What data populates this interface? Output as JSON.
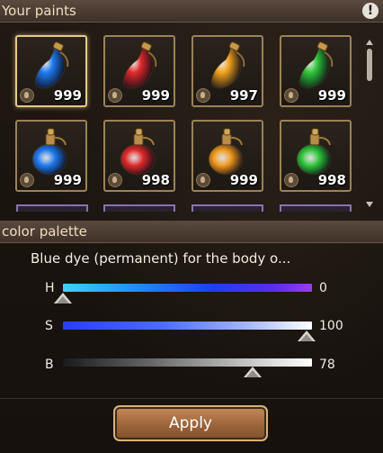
{
  "paints_header": {
    "title": "Your paints",
    "alert_icon": "!"
  },
  "paints": [
    {
      "color": "blue",
      "shape": "flask",
      "count": "999",
      "selected": true,
      "hex": "#1e7bf0"
    },
    {
      "color": "red",
      "shape": "flask",
      "count": "999",
      "selected": false,
      "hex": "#e02a2a"
    },
    {
      "color": "orange",
      "shape": "flask",
      "count": "997",
      "selected": false,
      "hex": "#f2a21c"
    },
    {
      "color": "green",
      "shape": "flask",
      "count": "999",
      "selected": false,
      "hex": "#2fc63a"
    },
    {
      "color": "blue",
      "shape": "round",
      "count": "999",
      "selected": false,
      "hex": "#1e7bf0"
    },
    {
      "color": "red",
      "shape": "round",
      "count": "998",
      "selected": false,
      "hex": "#e02a2a"
    },
    {
      "color": "orange",
      "shape": "round",
      "count": "999",
      "selected": false,
      "hex": "#f29a1c"
    },
    {
      "color": "green",
      "shape": "round",
      "count": "998",
      "selected": false,
      "hex": "#2fc63a"
    }
  ],
  "palette_header": {
    "title": "color palette"
  },
  "palette": {
    "description": "Blue dye (permanent) for the body o...",
    "sliders": [
      {
        "label": "H",
        "value": "0",
        "level": 0.0
      },
      {
        "label": "S",
        "value": "100",
        "level": 1.0
      },
      {
        "label": "B",
        "value": "78",
        "level": 0.78
      }
    ]
  },
  "apply_button": {
    "label": "Apply"
  },
  "colors": {
    "accent_gold": "#e7c98a",
    "button_brown": "#9a6238",
    "header_bg": "#4a3c32"
  }
}
